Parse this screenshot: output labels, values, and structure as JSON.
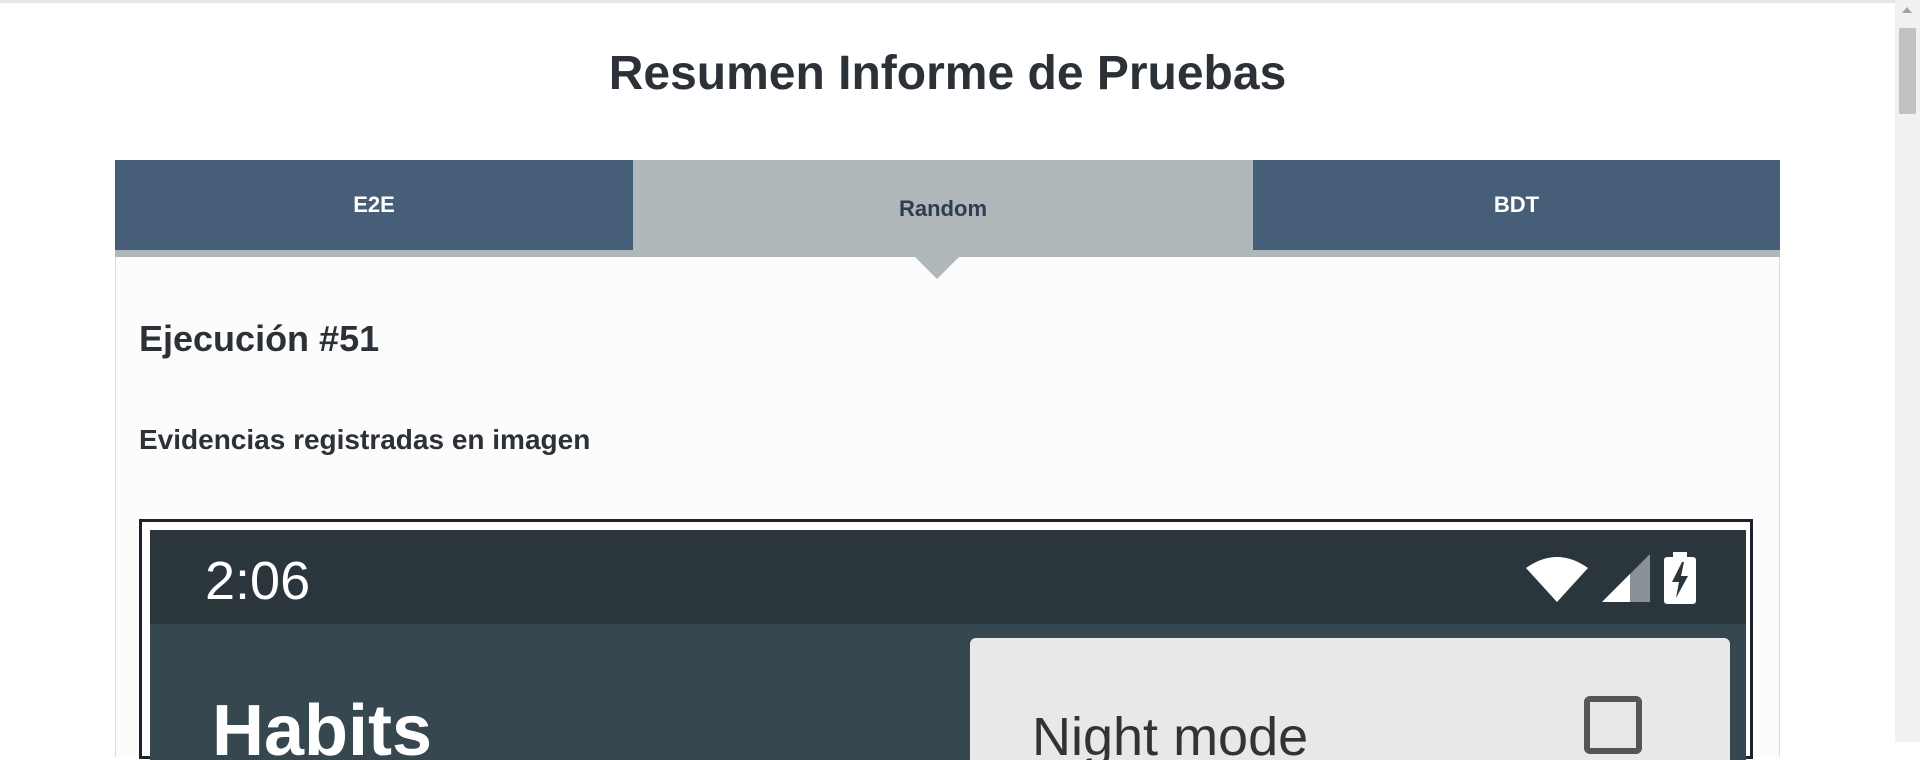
{
  "page": {
    "title": "Resumen Informe de Pruebas"
  },
  "tabs": [
    {
      "label": "E2E",
      "active": false
    },
    {
      "label": "Random",
      "active": true
    },
    {
      "label": "BDT",
      "active": false
    }
  ],
  "content": {
    "run_title": "Ejecución #51",
    "evidence_heading": "Evidencias registradas en imagen"
  },
  "screenshot": {
    "time": "2:06",
    "app_title": "Habits",
    "menu_item": "Night mode",
    "night_mode_checked": false,
    "status_icons": [
      "wifi-icon",
      "cell-signal-icon",
      "battery-charging-icon"
    ]
  },
  "colors": {
    "tab_inactive": "#465e78",
    "tab_active": "#b0b7ba",
    "title_text": "#2c3138",
    "phone_statusbar": "#2b353c",
    "phone_toolbar": "#37474f"
  }
}
